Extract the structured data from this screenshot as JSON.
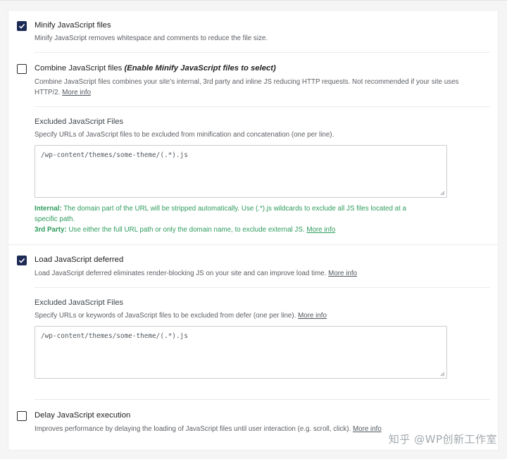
{
  "sections": [
    {
      "checked": true,
      "title": "Minify JavaScript files",
      "title_note": "",
      "desc": "Minify JavaScript removes whitespace and comments to reduce the file size.",
      "link": ""
    },
    {
      "checked": false,
      "title": "Combine JavaScript files",
      "title_note": "(Enable Minify JavaScript files to select)",
      "desc_line1": "Combine JavaScript files combines your site’s internal, 3rd party and inline JS reducing HTTP requests. Not recommended if your site uses",
      "desc_line2": "HTTP/2.",
      "link": "More info"
    },
    {
      "checked": true,
      "title": "Load JavaScript deferred",
      "desc": "Load JavaScript deferred eliminates render-blocking JS on your site and can improve load time.",
      "link": "More info"
    },
    {
      "checked": false,
      "title": "Delay JavaScript execution",
      "desc": "Improves performance by delaying the loading of JavaScript files until user interaction (e.g. scroll, click).",
      "link": "More info"
    }
  ],
  "excluded1": {
    "title": "Excluded JavaScript Files",
    "desc": "Specify URLs of JavaScript files to be excluded from minification and concatenation (one per line).",
    "value": "/wp-content/themes/some-theme/(.*).js",
    "note_internal_label": "Internal:",
    "note_internal_line1": "The domain part of the URL will be stripped automatically. Use (.*).js wildcards to exclude all JS files located at a",
    "note_internal_line2": "specific path.",
    "note_3rd_label": "3rd Party:",
    "note_3rd": "Use either the full URL path or only the domain name, to exclude external JS.",
    "note_link": "More info"
  },
  "excluded2": {
    "title": "Excluded JavaScript Files",
    "desc": "Specify URLs or keywords of JavaScript files to be excluded from defer (one per line).",
    "link": "More info",
    "value": "/wp-content/themes/some-theme/(.*).js"
  },
  "watermark": "知乎 @WP创新工作室"
}
